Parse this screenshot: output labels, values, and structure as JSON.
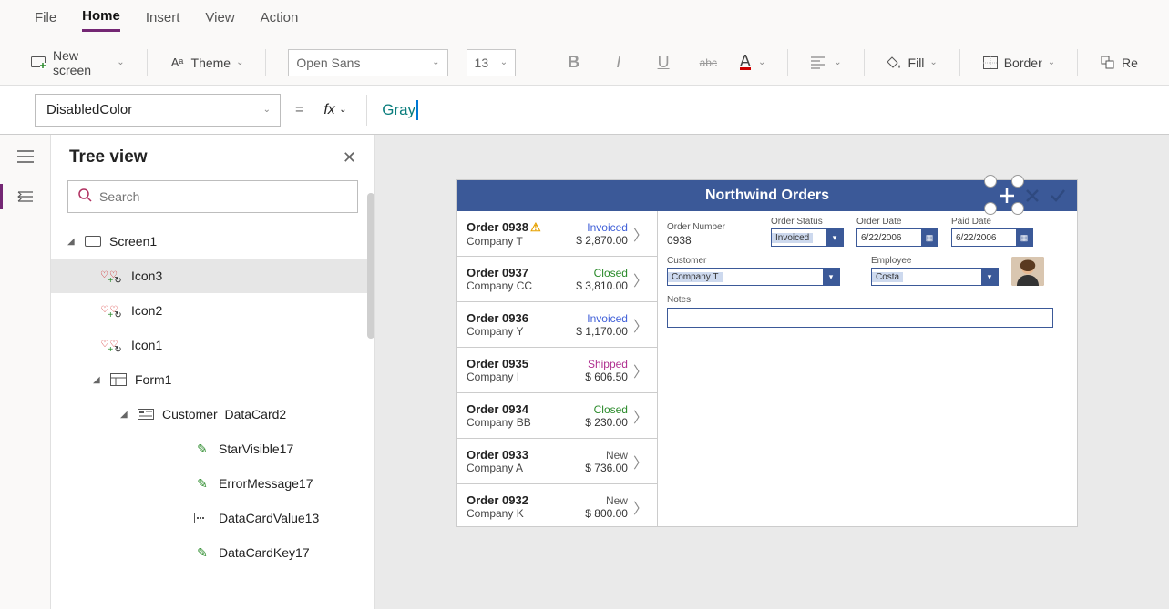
{
  "menu": {
    "items": [
      "File",
      "Home",
      "Insert",
      "View",
      "Action"
    ],
    "active": "Home"
  },
  "ribbon": {
    "new_screen": "New screen",
    "theme": "Theme",
    "font": "Open Sans",
    "font_size": "13",
    "fill": "Fill",
    "border": "Border",
    "reorder": "Re"
  },
  "formula": {
    "property": "DisabledColor",
    "value": "Gray"
  },
  "tree": {
    "title": "Tree view",
    "search_placeholder": "Search",
    "nodes": {
      "screen1": "Screen1",
      "icon3": "Icon3",
      "icon2": "Icon2",
      "icon1": "Icon1",
      "form1": "Form1",
      "customer_card": "Customer_DataCard2",
      "starvisible": "StarVisible17",
      "errormsg": "ErrorMessage17",
      "datacardvalue": "DataCardValue13",
      "datacardkey": "DataCardKey17"
    }
  },
  "preview": {
    "title": "Northwind Orders",
    "form_labels": {
      "order_number": "Order Number",
      "order_status": "Order Status",
      "order_date": "Order Date",
      "paid_date": "Paid Date",
      "customer": "Customer",
      "employee": "Employee",
      "notes": "Notes"
    },
    "form_values": {
      "order_number": "0938",
      "order_status": "Invoiced",
      "order_date": "6/22/2006",
      "paid_date": "6/22/2006",
      "customer": "Company T",
      "employee": "Costa"
    },
    "orders": [
      {
        "name": "Order 0938",
        "company": "Company T",
        "amount": "$ 2,870.00",
        "status": "Invoiced",
        "status_class": "invoiced",
        "warn": true
      },
      {
        "name": "Order 0937",
        "company": "Company CC",
        "amount": "$ 3,810.00",
        "status": "Closed",
        "status_class": "closed"
      },
      {
        "name": "Order 0936",
        "company": "Company Y",
        "amount": "$ 1,170.00",
        "status": "Invoiced",
        "status_class": "invoiced"
      },
      {
        "name": "Order 0935",
        "company": "Company I",
        "amount": "$ 606.50",
        "status": "Shipped",
        "status_class": "shipped"
      },
      {
        "name": "Order 0934",
        "company": "Company BB",
        "amount": "$ 230.00",
        "status": "Closed",
        "status_class": "closed"
      },
      {
        "name": "Order 0933",
        "company": "Company A",
        "amount": "$ 736.00",
        "status": "New",
        "status_class": "new"
      },
      {
        "name": "Order 0932",
        "company": "Company K",
        "amount": "$ 800.00",
        "status": "New",
        "status_class": "new"
      }
    ]
  }
}
